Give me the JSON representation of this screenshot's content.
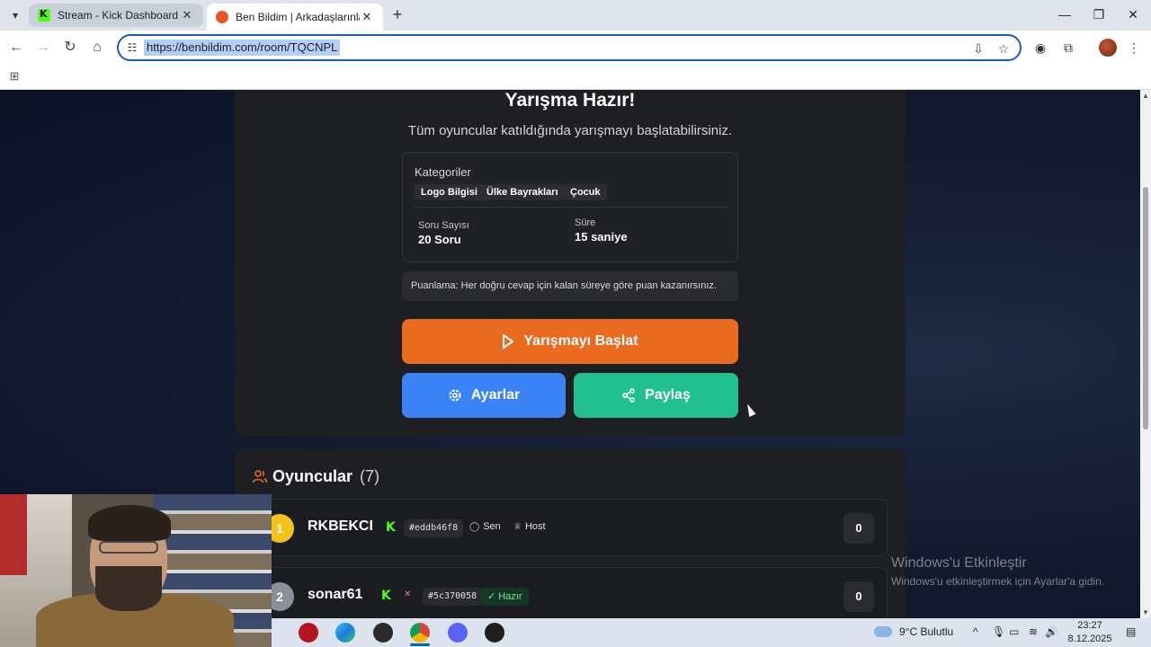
{
  "browser": {
    "tabs": [
      {
        "title": "Stream - Kick Dashboard",
        "active": false,
        "favicon": "kick-logo-icon"
      },
      {
        "title": "Ben Bildim | Arkadaşlarınla Online",
        "active": true,
        "favicon": "benbildim-icon"
      }
    ],
    "url": "https://benbildim.com/room/TQCNPL"
  },
  "page": {
    "heading": "Yarışma Hazır!",
    "subheading": "Tüm oyuncular katıldığında yarışmayı başlatabilirsiniz.",
    "categories_label": "Kategoriler",
    "categories": [
      "Logo Bilgisi",
      "Ülke Bayrakları",
      "Çocuk"
    ],
    "question_count_label": "Soru Sayısı",
    "question_count_value": "20 Soru",
    "duration_label": "Süre",
    "duration_value": "15 saniye",
    "scoring_note": "Puanlama: Her doğru cevap için kalan süreye göre puan kazanırsınız.",
    "start_button": "Yarışmayı Başlat",
    "settings_button": "Ayarlar",
    "share_button": "Paylaş"
  },
  "players": {
    "title": "Oyuncular",
    "count": "(7)",
    "list": [
      {
        "rank": "1",
        "name": "RKBEKCI",
        "hash": "#eddb46f8",
        "role1": "Sen",
        "role2": "Host",
        "score": "0"
      },
      {
        "rank": "2",
        "name": "sonar61",
        "hash": "#5c370058",
        "status": "Hazır",
        "score": "0"
      }
    ]
  },
  "watermark": {
    "title": "Windows'u Etkinleştir",
    "subtitle": "Windows'u etkinleştirmek için Ayarlar'a gidin."
  },
  "taskbar": {
    "weather": "9°C  Bulutlu",
    "time": "23:27",
    "date": "8.12.2025"
  },
  "colors": {
    "start": "#ea6b1f",
    "settings": "#3b82f6",
    "share": "#22c08e",
    "kick": "#53fc18"
  }
}
